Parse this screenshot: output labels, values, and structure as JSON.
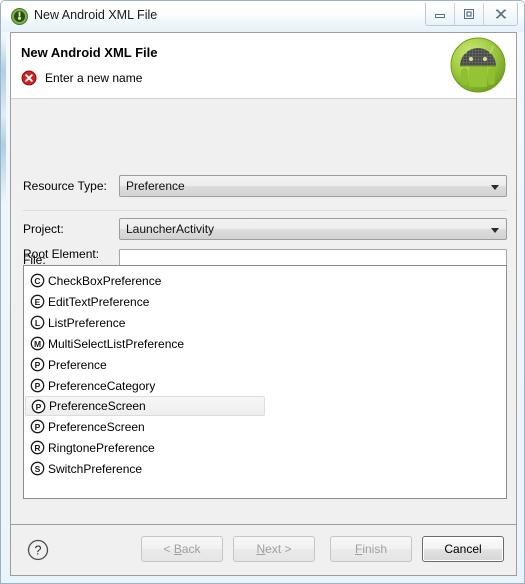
{
  "window": {
    "title": "New Android XML File",
    "icon": "android-head-icon",
    "controls": [
      {
        "name": "minimize-button",
        "glyph": "minimize"
      },
      {
        "name": "restore-button",
        "glyph": "restore"
      },
      {
        "name": "close-button",
        "glyph": "close"
      }
    ]
  },
  "header": {
    "title": "New Android XML File",
    "message": "Enter a new name",
    "message_icon": "error-icon",
    "banner_icon": "android-robot-icon",
    "error_color": "#cc2222"
  },
  "form": {
    "resource_type": {
      "label": "Resource Type:",
      "value": "Preference"
    },
    "project": {
      "label": "Project:",
      "value": "LauncherActivity"
    },
    "file": {
      "label": "File:",
      "value": "",
      "placeholder": ""
    }
  },
  "root_element": {
    "label": "Root Element:",
    "items": [
      {
        "icon": "C",
        "label": "CheckBoxPreference",
        "selected": false
      },
      {
        "icon": "E",
        "label": "EditTextPreference",
        "selected": false
      },
      {
        "icon": "L",
        "label": "ListPreference",
        "selected": false
      },
      {
        "icon": "M",
        "label": "MultiSelectListPreference",
        "selected": false
      },
      {
        "icon": "P",
        "label": "Preference",
        "selected": false
      },
      {
        "icon": "P",
        "label": "PreferenceCategory",
        "selected": false
      },
      {
        "icon": "P",
        "label": "PreferenceScreen",
        "selected": true
      },
      {
        "icon": "P",
        "label": "PreferenceScreen",
        "selected": false
      },
      {
        "icon": "R",
        "label": "RingtonePreference",
        "selected": false
      },
      {
        "icon": "S",
        "label": "SwitchPreference",
        "selected": false
      }
    ]
  },
  "buttons": {
    "help": "?",
    "back": {
      "label": "< Back",
      "mnemonic": "B",
      "enabled": false
    },
    "next": {
      "label": "Next >",
      "mnemonic": "N",
      "enabled": false
    },
    "finish": {
      "label": "Finish",
      "mnemonic": "F",
      "enabled": false
    },
    "cancel": {
      "label": "Cancel",
      "mnemonic": "",
      "enabled": true
    }
  }
}
